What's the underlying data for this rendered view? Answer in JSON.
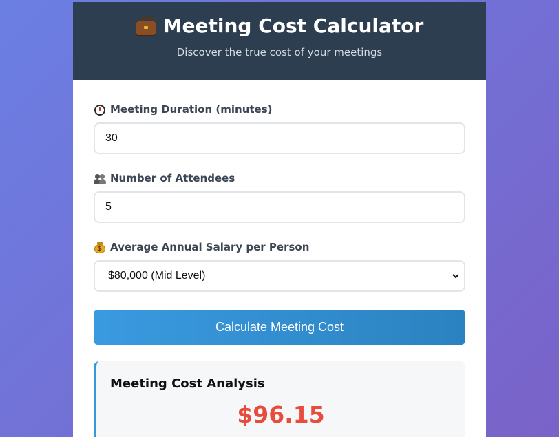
{
  "header": {
    "icon": "briefcase-icon",
    "title": "Meeting Cost Calculator",
    "subtitle": "Discover the true cost of your meetings"
  },
  "form": {
    "duration": {
      "icon": "stopwatch-icon",
      "label": "Meeting Duration (minutes)",
      "value": "30"
    },
    "attendees": {
      "icon": "people-icon",
      "label": "Number of Attendees",
      "value": "5"
    },
    "salary": {
      "icon": "money-bag-icon",
      "label": "Average Annual Salary per Person",
      "selected": "$80,000 (Mid Level)"
    },
    "calculate_label": "Calculate Meeting Cost"
  },
  "result": {
    "title": "Meeting Cost Analysis",
    "amount": "$96.15"
  },
  "colors": {
    "header_bg": "#2c3e50",
    "accent": "#3498db",
    "cost": "#e74c3c"
  }
}
